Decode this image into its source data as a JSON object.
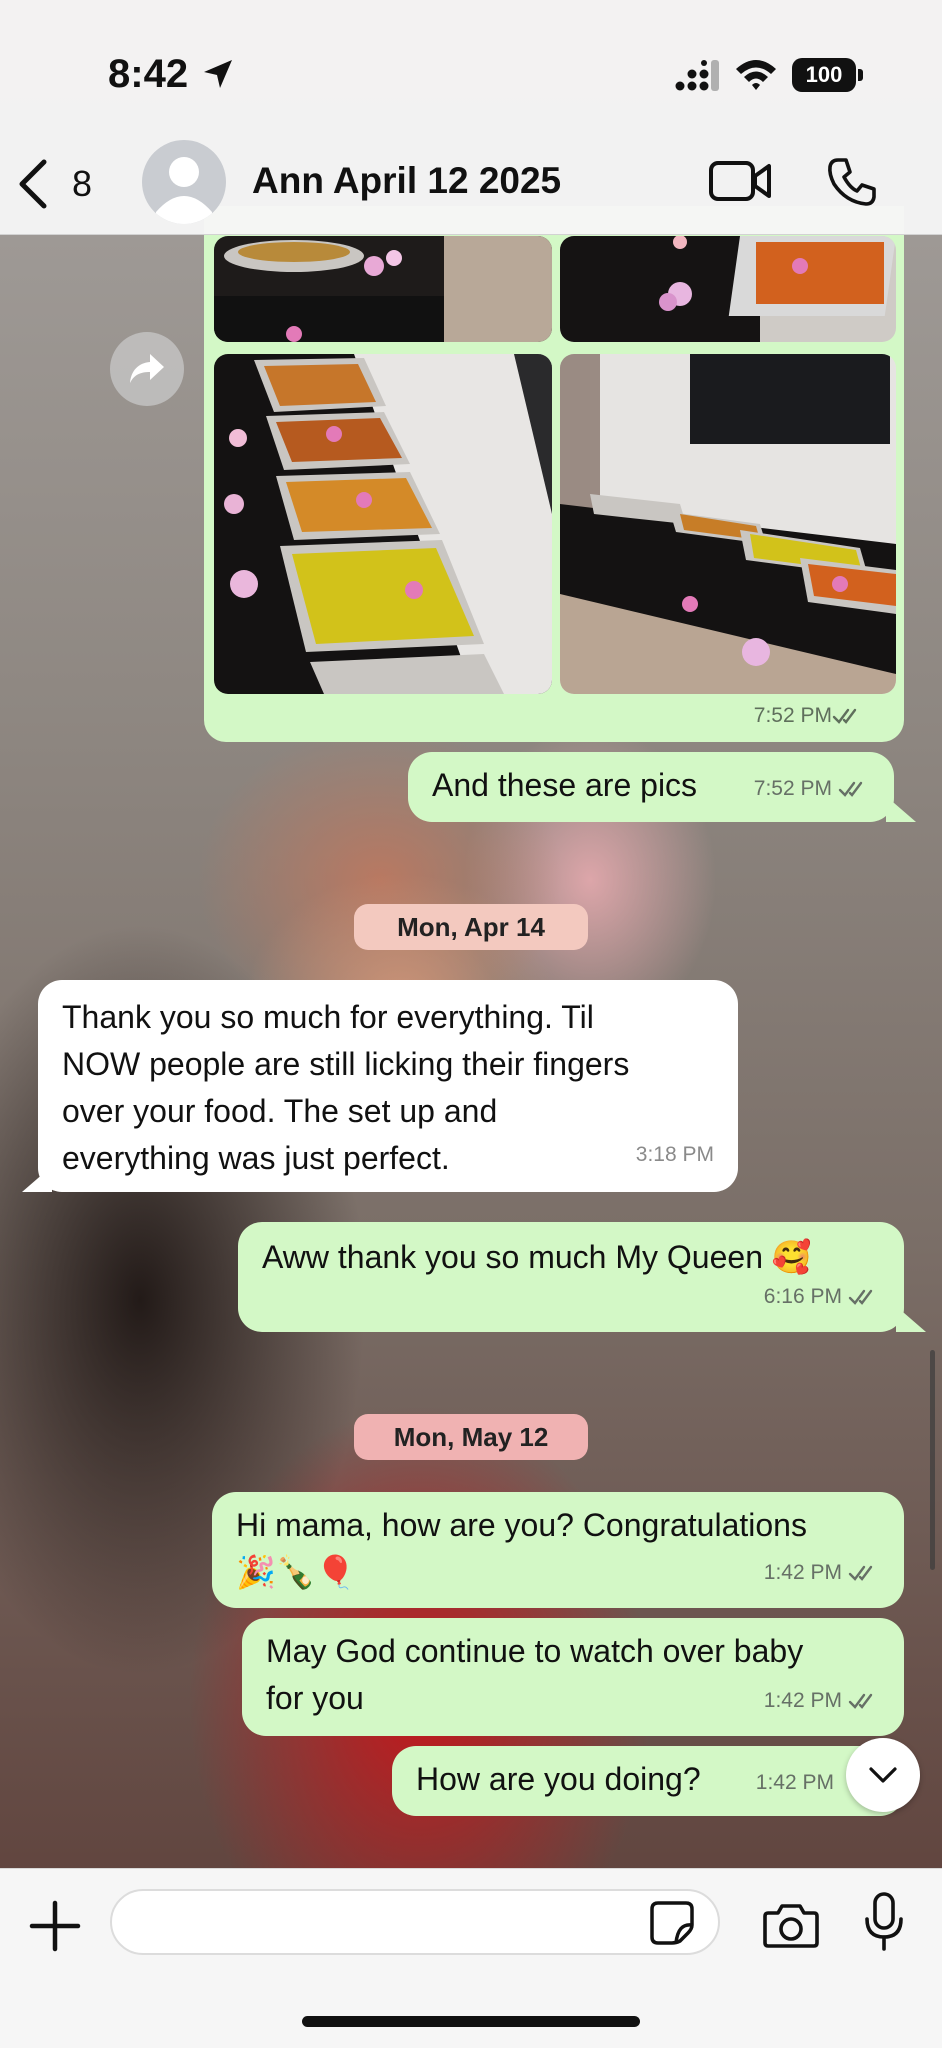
{
  "status_bar": {
    "time": "8:42",
    "battery": "100"
  },
  "header": {
    "back_count": "8",
    "contact_name": "Ann April 12 2025"
  },
  "messages": [
    {
      "type": "media",
      "direction": "out",
      "time": "7:52 PM"
    },
    {
      "type": "text",
      "direction": "out",
      "text": "And these are pics",
      "time": "7:52 PM"
    },
    {
      "type": "date",
      "text": "Mon, Apr 14"
    },
    {
      "type": "text",
      "direction": "in",
      "lines": [
        "Thank you so much for everything. Til",
        "NOW people are still licking their fingers",
        "over your food. The set up and",
        "everything was just perfect."
      ],
      "time": "3:18 PM"
    },
    {
      "type": "text",
      "direction": "out",
      "text": "Aww thank you so much My Queen",
      "emoji": "🥰",
      "time": "6:16 PM"
    },
    {
      "type": "date",
      "text": "Mon, May 12"
    },
    {
      "type": "text",
      "direction": "out",
      "lines": [
        "Hi mama, how are you? Congratulations",
        "🎉🍾🎈"
      ],
      "time": "1:42 PM"
    },
    {
      "type": "text",
      "direction": "out",
      "lines": [
        "May God continue to watch over baby",
        "for you"
      ],
      "time": "1:42 PM"
    },
    {
      "type": "text",
      "direction": "out",
      "text": "How are you doing?",
      "time": "1:42 PM"
    }
  ],
  "composer": {
    "placeholder": ""
  },
  "colors": {
    "outgoing_bubble": "#d3f8c6",
    "incoming_bubble": "#ffffff",
    "date_chip": "#f3c9bf"
  },
  "icons": [
    "location-arrow-icon",
    "signal-icon",
    "wifi-icon",
    "back-chevron-icon",
    "video-icon",
    "phone-icon",
    "forward-icon",
    "double-check-icon",
    "chevron-down-icon",
    "plus-icon",
    "sticker-icon",
    "camera-icon",
    "mic-icon"
  ]
}
